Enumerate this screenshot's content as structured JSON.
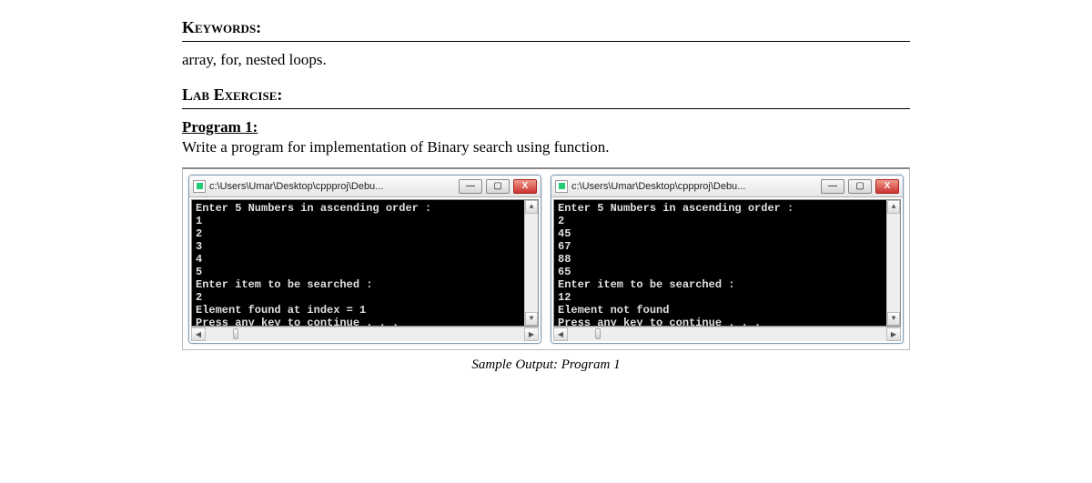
{
  "sections": {
    "keywords_heading": "Keywords:",
    "keywords_text": "array, for, nested loops.",
    "lab_heading": "Lab Exercise:",
    "program_label": "Program 1:",
    "program_desc": "Write a program for implementation of Binary search using function."
  },
  "console_left": {
    "title": "c:\\Users\\Umar\\Desktop\\cppproj\\Debu...",
    "body": "Enter 5 Numbers in ascending order :\n1\n2\n3\n4\n5\nEnter item to be searched :\n2\nElement found at index = 1\nPress any key to continue . . ."
  },
  "console_right": {
    "title": "c:\\Users\\Umar\\Desktop\\cppproj\\Debu...",
    "body": "Enter 5 Numbers in ascending order :\n2\n45\n67\n88\n65\nEnter item to be searched :\n12\nElement not found\nPress any key to continue . . ."
  },
  "caption": "Sample Output: Program 1",
  "win_controls": {
    "min": "—",
    "max": "▢",
    "close": "X"
  },
  "scroll_glyphs": {
    "up": "▲",
    "down": "▼",
    "left": "◀",
    "right": "▶"
  }
}
